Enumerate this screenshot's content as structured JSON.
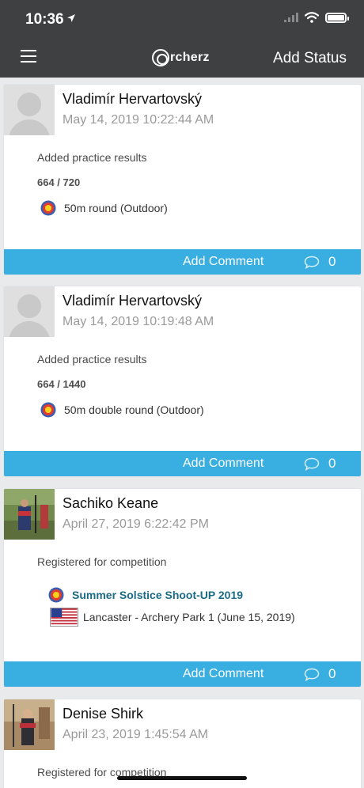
{
  "status_bar": {
    "time": "10:36"
  },
  "header": {
    "logo_letter_text": "rcherz",
    "add_status_label": "Add Status"
  },
  "posts": [
    {
      "name": "Vladimír Hervartovský",
      "date": "May 14, 2019 10:22:44 AM",
      "activity": "Added practice results",
      "score": "664 / 720",
      "round": "50m round (Outdoor)",
      "add_comment_label": "Add Comment",
      "comment_count": "0"
    },
    {
      "name": "Vladimír Hervartovský",
      "date": "May 14, 2019 10:19:48 AM",
      "activity": "Added practice results",
      "score": "664 / 1440",
      "round": "50m double round (Outdoor)",
      "add_comment_label": "Add Comment",
      "comment_count": "0"
    },
    {
      "name": "Sachiko Keane",
      "date": "April 27, 2019 6:22:42 PM",
      "activity": "Registered for competition",
      "competition": "Summer Solstice Shoot-UP 2019",
      "location": "Lancaster - Archery Park 1 (June 15, 2019)",
      "add_comment_label": "Add Comment",
      "comment_count": "0"
    },
    {
      "name": "Denise Shirk",
      "date": "April 23, 2019 1:45:54 AM",
      "activity": "Registered for competition"
    }
  ],
  "colors": {
    "header_bg": "#3f4042",
    "accent": "#39aee0",
    "link": "#1b6b86"
  }
}
